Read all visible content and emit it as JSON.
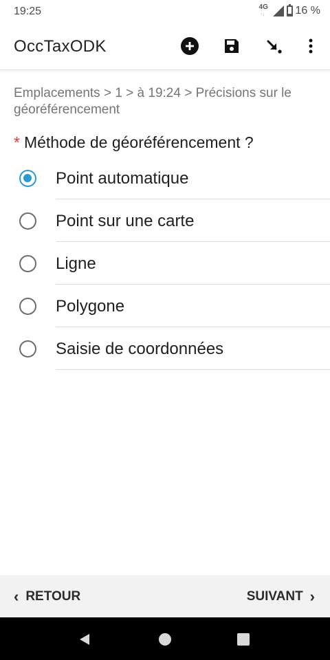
{
  "status_bar": {
    "time": "19:25",
    "network": "4G",
    "battery_text": "16 %",
    "battery_level": 0.16
  },
  "app_bar": {
    "title": "OccTaxODK",
    "icons": [
      "add-circle-icon",
      "save-icon",
      "jump-to-icon",
      "more-vert-icon"
    ]
  },
  "breadcrumb": "Emplacements > 1 > à 19:24 > Précisions sur le géoréférencement",
  "question": {
    "required_mark": "*",
    "label": "Méthode de géoréférencement ?"
  },
  "options": [
    {
      "label": "Point automatique",
      "selected": true
    },
    {
      "label": "Point sur une carte",
      "selected": false
    },
    {
      "label": "Ligne",
      "selected": false
    },
    {
      "label": "Polygone",
      "selected": false
    },
    {
      "label": "Saisie de coordonnées",
      "selected": false
    }
  ],
  "navigation": {
    "back_label": "RETOUR",
    "next_label": "SUIVANT"
  },
  "colors": {
    "accent": "#2a9bd2",
    "required": "#e53935"
  }
}
